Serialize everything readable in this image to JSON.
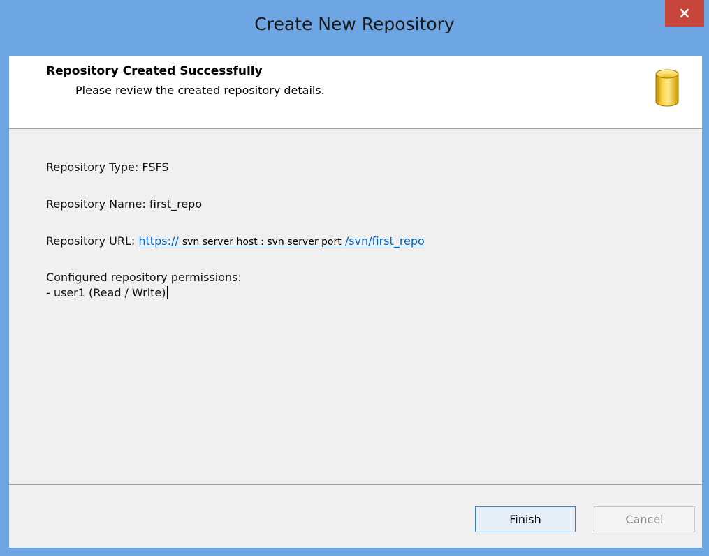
{
  "window": {
    "title": "Create New Repository",
    "close_icon": "close-icon"
  },
  "header": {
    "title": "Repository Created Successfully",
    "subtitle": "Please review the created repository details.",
    "icon": "database-icon"
  },
  "details": {
    "type_line": "Repository Type: FSFS",
    "name_line": "Repository Name: first_repo",
    "url_label": "Repository URL: ",
    "url_prefix": "https://",
    "url_host": "svn server host : svn server port",
    "url_suffix": "/svn/first_repo",
    "permissions_label": "Configured repository permissions:",
    "permissions": [
      "- user1 (Read / Write)"
    ]
  },
  "buttons": {
    "finish": "Finish",
    "cancel": "Cancel"
  },
  "colors": {
    "titlebar": "#6ea6e4",
    "close": "#c7463b",
    "link": "#0066cc"
  }
}
